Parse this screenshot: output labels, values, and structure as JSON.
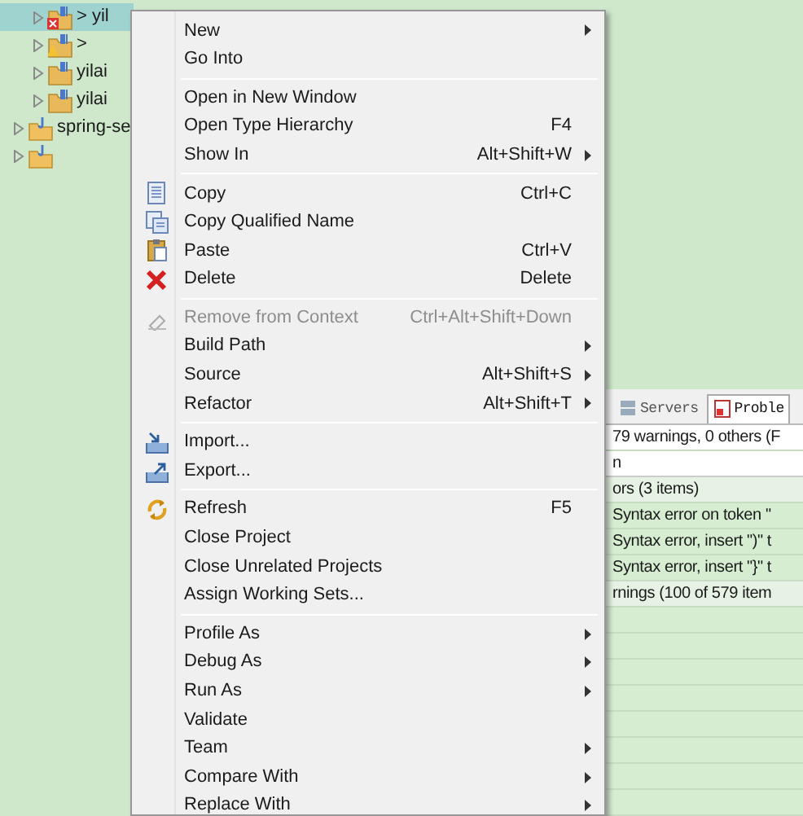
{
  "tree": {
    "items": [
      {
        "label": "> yil",
        "kind": "module",
        "has_error": true,
        "selected": true
      },
      {
        "label": ">",
        "kind": "module",
        "has_warning": true,
        "selected": false
      },
      {
        "label": "yilai",
        "kind": "module",
        "selected": false
      },
      {
        "label": "yilai",
        "kind": "module",
        "selected": false
      },
      {
        "label": "spring-se",
        "kind": "project",
        "selected": false
      },
      {
        "kind": "project",
        "selected": false
      }
    ]
  },
  "context_menu": {
    "groups": [
      [
        {
          "label": "New",
          "submenu": true,
          "disabled": false
        },
        {
          "label": "Go Into",
          "submenu": false,
          "disabled": false
        }
      ],
      [
        {
          "label": "Open in New Window",
          "submenu": false,
          "disabled": false
        },
        {
          "label": "Open Type Hierarchy",
          "shortcut": "F4",
          "submenu": false,
          "disabled": false
        },
        {
          "label": "Show In",
          "shortcut": "Alt+Shift+W",
          "submenu": true,
          "disabled": false
        }
      ],
      [
        {
          "label": "Copy",
          "kind": "copy",
          "shortcut": "Ctrl+C",
          "submenu": false,
          "disabled": false
        },
        {
          "label": "Copy Qualified Name",
          "kind": "copy-qualified",
          "submenu": false,
          "disabled": false
        },
        {
          "label": "Paste",
          "kind": "paste",
          "shortcut": "Ctrl+V",
          "submenu": false,
          "disabled": false
        },
        {
          "label": "Delete",
          "kind": "delete",
          "shortcut": "Delete",
          "submenu": false,
          "disabled": false
        }
      ],
      [
        {
          "label": "Remove from Context",
          "kind": "remove",
          "shortcut": "Ctrl+Alt+Shift+Down",
          "submenu": false,
          "disabled": true
        },
        {
          "label": "Build Path",
          "submenu": true,
          "disabled": false
        },
        {
          "label": "Source",
          "shortcut": "Alt+Shift+S",
          "submenu": true,
          "disabled": false
        },
        {
          "label": "Refactor",
          "shortcut": "Alt+Shift+T",
          "submenu": true,
          "disabled": false
        }
      ],
      [
        {
          "label": "Import...",
          "kind": "import",
          "submenu": false,
          "disabled": false
        },
        {
          "label": "Export...",
          "kind": "export",
          "submenu": false,
          "disabled": false
        }
      ],
      [
        {
          "label": "Refresh",
          "kind": "refresh",
          "shortcut": "F5",
          "submenu": false,
          "disabled": false
        },
        {
          "label": "Close Project",
          "submenu": false,
          "disabled": false
        },
        {
          "label": "Close Unrelated Projects",
          "submenu": false,
          "disabled": false
        },
        {
          "label": "Assign Working Sets...",
          "submenu": false,
          "disabled": false
        }
      ],
      [
        {
          "label": "Profile As",
          "submenu": true,
          "disabled": false
        },
        {
          "label": "Debug As",
          "submenu": true,
          "disabled": false
        },
        {
          "label": "Run As",
          "submenu": true,
          "disabled": false
        },
        {
          "label": "Validate",
          "submenu": false,
          "disabled": false
        },
        {
          "label": "Team",
          "submenu": true,
          "disabled": false
        },
        {
          "label": "Compare With",
          "submenu": true,
          "disabled": false
        },
        {
          "label": "Replace With",
          "submenu": true,
          "disabled": false
        }
      ]
    ]
  },
  "problems_panel": {
    "tabs": [
      {
        "label": "Servers",
        "selected": false
      },
      {
        "label": "Proble",
        "selected": true
      }
    ],
    "summary": "79 warnings, 0 others (F",
    "column_1": "n",
    "rows": [
      {
        "kind": "group",
        "text": "ors (3 items)"
      },
      {
        "kind": "entry",
        "text": "Syntax error on token \""
      },
      {
        "kind": "entry",
        "text": "Syntax error, insert \")\" t"
      },
      {
        "kind": "entry",
        "text": "Syntax error, insert \"}\" t"
      },
      {
        "kind": "group",
        "text": "rnings (100 of 579 item"
      }
    ]
  }
}
